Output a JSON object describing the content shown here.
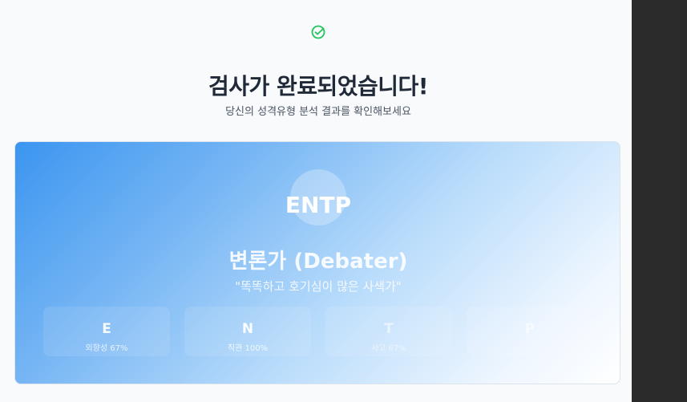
{
  "header": {
    "title": "검사가 완료되었습니다!",
    "subtitle": "당신의 성격유형 분석 결과를 확인해보세요",
    "status_icon": "check-circle-icon",
    "status_color": "#22c55e"
  },
  "result": {
    "type_code": "ENTP",
    "type_name": "변론가 (Debater)",
    "quote": "\"똑똑하고 호기심이 많은 사색가\"",
    "gradient_start": "#3b95f0",
    "gradient_end": "#ffffff",
    "traits": [
      {
        "letter": "E",
        "desc": "외향성 67%"
      },
      {
        "letter": "N",
        "desc": "직관 100%"
      },
      {
        "letter": "T",
        "desc": "사고 67%"
      },
      {
        "letter": "P",
        "desc": ""
      }
    ]
  }
}
